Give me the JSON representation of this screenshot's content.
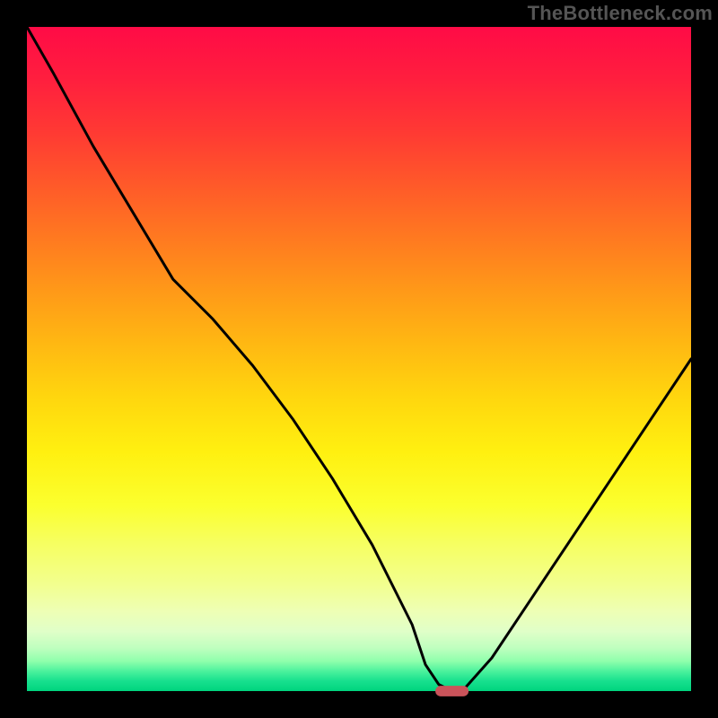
{
  "watermark": "TheBottleneck.com",
  "chart_data": {
    "type": "line",
    "title": "",
    "xlabel": "",
    "ylabel": "",
    "xlim": [
      0,
      100
    ],
    "ylim": [
      0,
      100
    ],
    "grid": false,
    "series": [
      {
        "name": "bottleneck-curve",
        "x": [
          0,
          4,
          10,
          16,
          22,
          28,
          34,
          40,
          46,
          52,
          58,
          60,
          62,
          64,
          66,
          70,
          76,
          82,
          88,
          94,
          100
        ],
        "y": [
          100,
          93,
          82,
          72,
          62,
          56,
          49,
          41,
          32,
          22,
          10,
          4,
          1,
          0,
          0.5,
          5,
          14,
          23,
          32,
          41,
          50
        ]
      }
    ],
    "marker": {
      "name": "optimal-marker",
      "x": 64,
      "y": 0,
      "color": "#c9535a",
      "width": 5,
      "height": 1.6
    },
    "background": {
      "type": "vertical-gradient",
      "stops": [
        {
          "pos": 0.0,
          "color": "#ff0b46"
        },
        {
          "pos": 0.5,
          "color": "#ffd70e"
        },
        {
          "pos": 0.8,
          "color": "#f6ff63"
        },
        {
          "pos": 1.0,
          "color": "#00d47e"
        }
      ]
    }
  }
}
